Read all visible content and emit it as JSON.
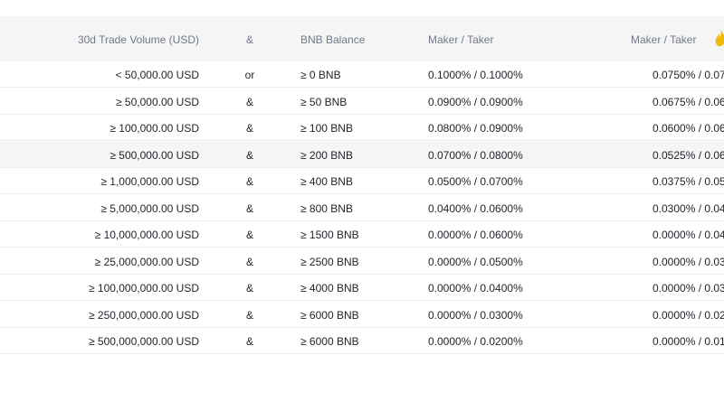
{
  "table": {
    "headers": {
      "volume": "30d Trade Volume (USD)",
      "operator": "&",
      "bnb": "BNB Balance",
      "maker_taker": "Maker  /  Taker",
      "maker_taker_discount": "Maker   /   Taker"
    },
    "highlight_color": "#f5f5f5",
    "rows": [
      {
        "volume": "< 50,000.00 USD",
        "operator": "or",
        "bnb": "≥ 0 BNB",
        "maker_taker": "0.1000% / 0.1000%",
        "maker_taker_discount": "0.0750% / 0.07"
      },
      {
        "volume": "≥ 50,000.00 USD",
        "operator": "&",
        "bnb": "≥ 50 BNB",
        "maker_taker": "0.0900% / 0.0900%",
        "maker_taker_discount": "0.0675% / 0.06"
      },
      {
        "volume": "≥ 100,000.00 USD",
        "operator": "&",
        "bnb": "≥ 100 BNB",
        "maker_taker": "0.0800% / 0.0900%",
        "maker_taker_discount": "0.0600% / 0.06"
      },
      {
        "volume": "≥ 500,000.00 USD",
        "operator": "&",
        "bnb": "≥ 200 BNB",
        "maker_taker": "0.0700% / 0.0800%",
        "maker_taker_discount": "0.0525% / 0.06"
      },
      {
        "volume": "≥ 1,000,000.00 USD",
        "operator": "&",
        "bnb": "≥ 400 BNB",
        "maker_taker": "0.0500% / 0.0700%",
        "maker_taker_discount": "0.0375% / 0.05"
      },
      {
        "volume": "≥ 5,000,000.00 USD",
        "operator": "&",
        "bnb": "≥ 800 BNB",
        "maker_taker": "0.0400% / 0.0600%",
        "maker_taker_discount": "0.0300% / 0.04"
      },
      {
        "volume": "≥ 10,000,000.00 USD",
        "operator": "&",
        "bnb": "≥ 1500 BNB",
        "maker_taker": "0.0000% / 0.0600%",
        "maker_taker_discount": "0.0000% / 0.04"
      },
      {
        "volume": "≥ 25,000,000.00 USD",
        "operator": "&",
        "bnb": "≥ 2500 BNB",
        "maker_taker": "0.0000% / 0.0500%",
        "maker_taker_discount": "0.0000% / 0.03"
      },
      {
        "volume": "≥ 100,000,000.00 USD",
        "operator": "&",
        "bnb": "≥ 4000 BNB",
        "maker_taker": "0.0000% / 0.0400%",
        "maker_taker_discount": "0.0000% / 0.03"
      },
      {
        "volume": "≥ 250,000,000.00 USD",
        "operator": "&",
        "bnb": "≥ 6000 BNB",
        "maker_taker": "0.0000% / 0.0300%",
        "maker_taker_discount": "0.0000% / 0.02"
      },
      {
        "volume": "≥ 500,000,000.00 USD",
        "operator": "&",
        "bnb": "≥ 6000 BNB",
        "maker_taker": "0.0000% / 0.0200%",
        "maker_taker_discount": "0.0000% / 0.01"
      }
    ]
  },
  "icons": {
    "discount": "fire-icon"
  },
  "colors": {
    "header_text": "#707a8a",
    "body_text": "#1e2329",
    "fire": "#f0b90b",
    "divider": "#eaecef"
  }
}
